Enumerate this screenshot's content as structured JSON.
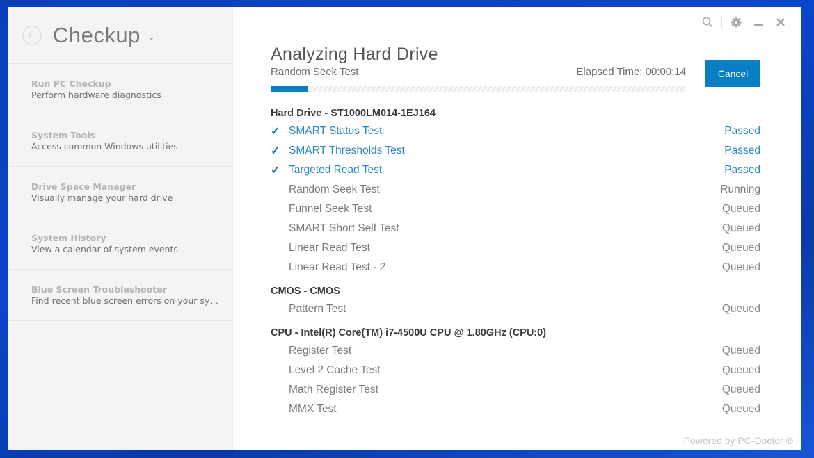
{
  "app": {
    "title": "Checkup"
  },
  "sidebar": {
    "items": [
      {
        "title": "Run PC Checkup",
        "desc": "Perform hardware diagnostics"
      },
      {
        "title": "System Tools",
        "desc": "Access common Windows utilities"
      },
      {
        "title": "Drive Space Manager",
        "desc": "Visually manage your hard drive"
      },
      {
        "title": "System History",
        "desc": "View a calendar of system events"
      },
      {
        "title": "Blue Screen Troubleshooter",
        "desc": "Find recent blue screen errors on your syste..."
      }
    ]
  },
  "main": {
    "heading": "Analyzing Hard Drive",
    "current_test": "Random Seek Test",
    "elapsed": "Elapsed Time: 00:00:14",
    "progress_percent": 9,
    "cancel_label": "Cancel",
    "groups": [
      {
        "title": "Hard Drive - ST1000LM014-1EJ164",
        "tests": [
          {
            "name": "SMART Status Test",
            "status": "Passed",
            "state": "passed"
          },
          {
            "name": "SMART Thresholds Test",
            "status": "Passed",
            "state": "passed"
          },
          {
            "name": "Targeted Read Test",
            "status": "Passed",
            "state": "passed"
          },
          {
            "name": "Random Seek Test",
            "status": "Running",
            "state": "running"
          },
          {
            "name": "Funnel Seek Test",
            "status": "Queued",
            "state": "queued"
          },
          {
            "name": "SMART Short Self Test",
            "status": "Queued",
            "state": "queued"
          },
          {
            "name": "Linear Read Test",
            "status": "Queued",
            "state": "queued"
          },
          {
            "name": "Linear Read Test - 2",
            "status": "Queued",
            "state": "queued"
          }
        ]
      },
      {
        "title": "CMOS - CMOS",
        "tests": [
          {
            "name": "Pattern Test",
            "status": "Queued",
            "state": "queued"
          }
        ]
      },
      {
        "title": "CPU - Intel(R) Core(TM) i7-4500U CPU @ 1.80GHz (CPU:0)",
        "tests": [
          {
            "name": "Register Test",
            "status": "Queued",
            "state": "queued"
          },
          {
            "name": "Level 2 Cache Test",
            "status": "Queued",
            "state": "queued"
          },
          {
            "name": "Math Register Test",
            "status": "Queued",
            "state": "queued"
          },
          {
            "name": "MMX Test",
            "status": "Queued",
            "state": "queued"
          }
        ]
      }
    ]
  },
  "icons": {
    "check": "✓",
    "back": "←",
    "chevron": "⌄"
  },
  "footer": "Powered by PC-Doctor ®",
  "colors": {
    "accent": "#0a7ec2",
    "passed": "#2a86c4"
  }
}
